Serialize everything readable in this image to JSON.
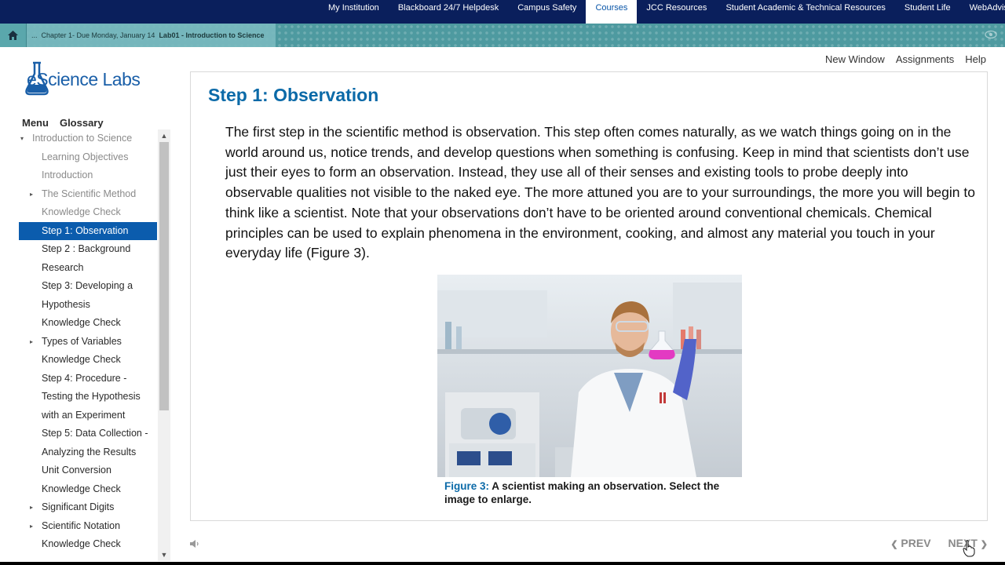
{
  "topnav": {
    "tabs": [
      {
        "label": "My Institution"
      },
      {
        "label": "Blackboard 24/7 Helpdesk"
      },
      {
        "label": "Campus Safety"
      },
      {
        "label": "Courses"
      },
      {
        "label": "JCC Resources"
      },
      {
        "label": "Student Academic & Technical Resources"
      },
      {
        "label": "Student Life"
      },
      {
        "label": "WebAdvisor"
      }
    ],
    "active_tab": "Courses"
  },
  "breadcrumb": {
    "ellipsis": "...",
    "chapter": "Chapter 1- Due Monday, January 14",
    "current": "Lab01 - Introduction to Science"
  },
  "toplinks": {
    "new_window": "New Window",
    "assignments": "Assignments",
    "help": "Help"
  },
  "logo": {
    "text": "eScience Labs"
  },
  "sidebar": {
    "menu_label": "Menu",
    "glossary_label": "Glossary",
    "items": [
      {
        "label": "Introduction to Science",
        "style": "top dim",
        "arrow": "▾"
      },
      {
        "label": "Learning Objectives",
        "style": "dim"
      },
      {
        "label": "Introduction",
        "style": "dim"
      },
      {
        "label": "The Scientific Method",
        "style": "dim",
        "arrow": "▸"
      },
      {
        "label": "Knowledge Check",
        "style": "dim"
      },
      {
        "label": "Step 1: Observation",
        "style": "active"
      },
      {
        "label": "Step 2 : Background Research",
        "style": ""
      },
      {
        "label": "Step 3: Developing a Hypothesis",
        "style": ""
      },
      {
        "label": "Knowledge Check",
        "style": ""
      },
      {
        "label": "Types of Variables",
        "style": "",
        "arrow": "▸"
      },
      {
        "label": "Knowledge Check",
        "style": ""
      },
      {
        "label": "Step 4: Procedure - Testing the Hypothesis with an Experiment",
        "style": ""
      },
      {
        "label": "Step 5: Data Collection - Analyzing the Results",
        "style": ""
      },
      {
        "label": "Unit Conversion",
        "style": ""
      },
      {
        "label": "Knowledge Check",
        "style": ""
      },
      {
        "label": "Significant Digits",
        "style": "",
        "arrow": "▸"
      },
      {
        "label": "Scientific Notation",
        "style": "",
        "arrow": "▸"
      },
      {
        "label": "Knowledge Check",
        "style": ""
      }
    ]
  },
  "content": {
    "title": "Step 1: Observation",
    "paragraph": "The first step in the scientific method is observation. This step often comes naturally, as we watch things going on in the world around us, notice trends, and develop questions when something is confusing. Keep in mind that scientists don’t use just their eyes to form an observation. Instead, they use all of their senses and existing tools to probe deeply into observable qualities not visible to the naked eye. The more attuned you are to your surroundings, the more you will begin to think like a scientist. Note that your observations don’t have to be oriented around conventional chemicals. Chemical principles can be used to explain phenomena in the environment, cooking, and almost any material you touch in your everyday life (Figure 3).",
    "figure_label": "Figure 3:",
    "figure_caption": "A scientist making an observation. Select the image to enlarge."
  },
  "footer": {
    "prev": "PREV",
    "next": "NEXT"
  },
  "colors": {
    "nav_bg": "#0a1f5c",
    "accent": "#0b5cad",
    "title": "#0b6aa8",
    "breadcrumb_bg": "#4e9aa0"
  }
}
